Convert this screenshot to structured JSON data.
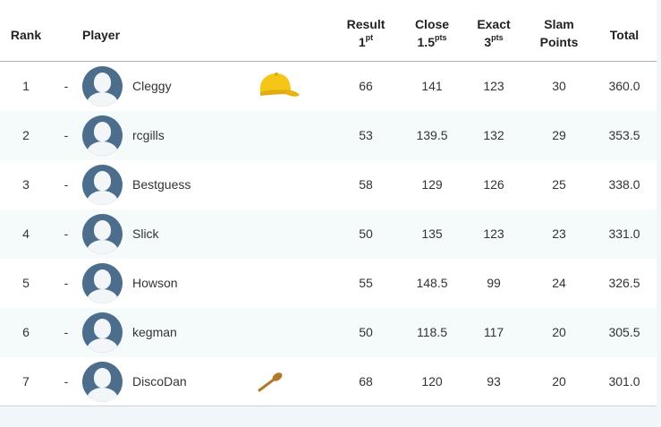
{
  "headers": {
    "rank": "Rank",
    "player": "Player",
    "result_line1": "Result",
    "result_line2": "1",
    "result_unit": "pt",
    "close_line1": "Close",
    "close_line2": "1.5",
    "close_unit": "pts",
    "exact_line1": "Exact",
    "exact_line2": "3",
    "exact_unit": "pts",
    "slam_line1": "Slam",
    "slam_line2": "Points",
    "total": "Total"
  },
  "rows": [
    {
      "rank": "1",
      "move": "-",
      "name": "Cleggy",
      "badge": "yellow-cap-icon",
      "result": "66",
      "close": "141",
      "exact": "123",
      "slam": "30",
      "total": "360.0"
    },
    {
      "rank": "2",
      "move": "-",
      "name": "rcgills",
      "badge": "",
      "result": "53",
      "close": "139.5",
      "exact": "132",
      "slam": "29",
      "total": "353.5"
    },
    {
      "rank": "3",
      "move": "-",
      "name": "Bestguess",
      "badge": "",
      "result": "58",
      "close": "129",
      "exact": "126",
      "slam": "25",
      "total": "338.0"
    },
    {
      "rank": "4",
      "move": "-",
      "name": "Slick",
      "badge": "",
      "result": "50",
      "close": "135",
      "exact": "123",
      "slam": "23",
      "total": "331.0"
    },
    {
      "rank": "5",
      "move": "-",
      "name": "Howson",
      "badge": "",
      "result": "55",
      "close": "148.5",
      "exact": "99",
      "slam": "24",
      "total": "326.5"
    },
    {
      "rank": "6",
      "move": "-",
      "name": "kegman",
      "badge": "",
      "result": "50",
      "close": "118.5",
      "exact": "117",
      "slam": "20",
      "total": "305.5"
    },
    {
      "rank": "7",
      "move": "-",
      "name": "DiscoDan",
      "badge": "wooden-spoon-icon",
      "result": "68",
      "close": "120",
      "exact": "93",
      "slam": "20",
      "total": "301.0"
    }
  ],
  "colors": {
    "avatar": "#4c6d8b",
    "cap": "#f5c518",
    "spoon": "#b07a2a",
    "row_alt": "#f5fafb"
  }
}
